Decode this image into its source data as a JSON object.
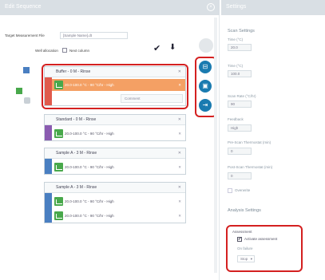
{
  "left_panel": {
    "title": "Edit Sequence",
    "close_icon": "close-icon",
    "target_file_label": "Target Measurement File",
    "target_file_value": "[Sample Name].dt",
    "well_allocation_label": "Well allocation",
    "well_allocation_value": "Next column",
    "sequences": [
      {
        "name": "Buffer - 0 M - Rinse",
        "color": "#e05a4c",
        "methods": [
          {
            "text": "20.0-100.0 °C - 90 °C/hr - High",
            "selected": true
          }
        ],
        "comment_label": "Comment"
      },
      {
        "name": "Standard - 0 M - Rinse",
        "color": "#8a5bb0",
        "methods": [
          {
            "text": "20.0-100.0 °C - 90 °C/hr - High",
            "selected": false
          }
        ]
      },
      {
        "name": "Sample A - 3 M - Rinse",
        "color": "#4a7fc1",
        "methods": [
          {
            "text": "20.0-100.0 °C - 90 °C/hr - High",
            "selected": false
          }
        ]
      },
      {
        "name": "Sample A - 3 M - Rinse",
        "color": "#4a7fc1",
        "methods": [
          {
            "text": "20.0-100.0 °C - 90 °C/hr - High",
            "selected": false
          },
          {
            "text": "20.0-100.0 °C - 90 °C/hr - High",
            "selected": false
          }
        ]
      }
    ]
  },
  "right_panel": {
    "title": "Settings",
    "scan_settings_title": "Scan Settings",
    "fields": [
      {
        "label": "Time (°C)",
        "value": "20.0"
      },
      {
        "label": "Time (°C)",
        "value": "100.0"
      },
      {
        "label": "Scan Rate (°C/hr)",
        "value": "90"
      },
      {
        "label": "Feedback",
        "value": "High"
      },
      {
        "label": "Pre-Scan Thermostat (min)",
        "value": "0"
      },
      {
        "label": "Post-Scan Thermostat (min)",
        "value": "0"
      }
    ],
    "overwrite_label": "Overwrite",
    "analysis_settings_title": "Analysis Settings",
    "assessment_label": "Assessment",
    "auto_assessment_label": "Activate assessment",
    "on_failure_label": "On failure",
    "on_failure_value": "Stop"
  }
}
